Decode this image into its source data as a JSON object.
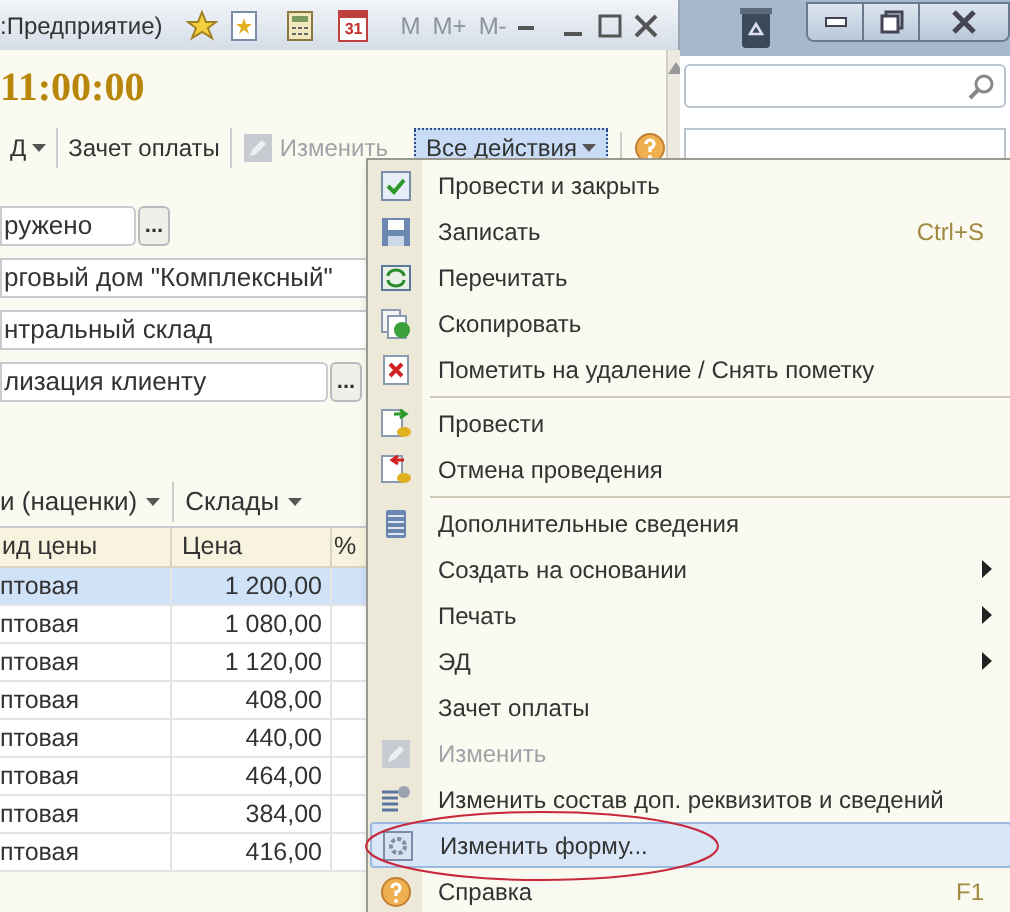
{
  "window": {
    "title": ":Предприятие)",
    "calendar_day": "31",
    "memory_buttons": [
      "M",
      "M+",
      "M-"
    ]
  },
  "document": {
    "time": "11:00:00"
  },
  "toolbar": [
    {
      "label": "Д",
      "kind": "dropdown",
      "disabled": false,
      "pressed": false
    },
    {
      "label": "Зачет оплаты",
      "kind": "button",
      "disabled": false,
      "pressed": false
    },
    {
      "label": "Изменить",
      "kind": "edit",
      "disabled": true,
      "pressed": false
    },
    {
      "label": "Все действия",
      "kind": "dropdown",
      "disabled": false,
      "pressed": true
    },
    {
      "kind": "help"
    }
  ],
  "fields": [
    {
      "value": "ружено",
      "kind": "short-choice",
      "button": "..."
    },
    {
      "value": "рговый дом \"Комплексный\"",
      "kind": "plain"
    },
    {
      "value": "нтральный склад",
      "kind": "plain"
    },
    {
      "value": "лизация клиенту",
      "kind": "long-choice",
      "button": "..."
    }
  ],
  "table_toolbar": [
    {
      "label": "и (наценки)"
    },
    {
      "label": "Склады"
    }
  ],
  "table": {
    "columns": [
      "ид цены",
      "Цена",
      "%"
    ],
    "rows": [
      {
        "cells": [
          "птовая",
          "1 200,00"
        ],
        "selected": true
      },
      {
        "cells": [
          "птовая",
          "1 080,00"
        ],
        "selected": false
      },
      {
        "cells": [
          "птовая",
          "1 120,00"
        ],
        "selected": false
      },
      {
        "cells": [
          "птовая",
          "408,00"
        ],
        "selected": false
      },
      {
        "cells": [
          "птовая",
          "440,00"
        ],
        "selected": false
      },
      {
        "cells": [
          "птовая",
          "464,00"
        ],
        "selected": false
      },
      {
        "cells": [
          "птовая",
          "384,00"
        ],
        "selected": false
      },
      {
        "cells": [
          "птовая",
          "416,00"
        ],
        "selected": false
      }
    ]
  },
  "menu": [
    {
      "kind": "check",
      "label": "Провести и закрыть",
      "disabled": false,
      "selected": false,
      "circled": false
    },
    {
      "kind": "save",
      "label": "Записать",
      "shortcut": "Ctrl+S",
      "disabled": false,
      "selected": false,
      "circled": false
    },
    {
      "kind": "reread",
      "label": "Перечитать",
      "disabled": false,
      "selected": false,
      "circled": false
    },
    {
      "kind": "copy",
      "label": "Скопировать",
      "disabled": false,
      "selected": false,
      "circled": false
    },
    {
      "kind": "delete",
      "label": "Пометить на удаление / Снять пометку",
      "disabled": false,
      "selected": false,
      "circled": false
    },
    {
      "kind": "separator"
    },
    {
      "kind": "post",
      "label": "Провести",
      "disabled": false,
      "selected": false,
      "circled": false
    },
    {
      "kind": "unpost",
      "label": "Отмена проведения",
      "disabled": false,
      "selected": false,
      "circled": false
    },
    {
      "kind": "separator"
    },
    {
      "kind": "list",
      "label": "Дополнительные сведения",
      "disabled": false,
      "selected": false,
      "circled": false
    },
    {
      "kind": "submenu",
      "label": "Создать на основании",
      "disabled": false,
      "selected": false,
      "circled": false
    },
    {
      "kind": "submenu",
      "label": "Печать",
      "disabled": false,
      "selected": false,
      "circled": false
    },
    {
      "kind": "submenu",
      "label": "ЭД",
      "disabled": false,
      "selected": false,
      "circled": false
    },
    {
      "kind": "text",
      "label": "Зачет оплаты",
      "disabled": false,
      "selected": false,
      "circled": false
    },
    {
      "kind": "pencil",
      "label": "Изменить",
      "disabled": true,
      "selected": false,
      "circled": false
    },
    {
      "kind": "props",
      "label": "Изменить состав доп. реквизитов и сведений",
      "disabled": false,
      "selected": false,
      "circled": false
    },
    {
      "kind": "form",
      "label": "Изменить форму...",
      "disabled": false,
      "selected": true,
      "circled": true
    },
    {
      "kind": "help",
      "label": "Справка",
      "shortcut": "F1",
      "disabled": false,
      "selected": false,
      "circled": false
    }
  ]
}
